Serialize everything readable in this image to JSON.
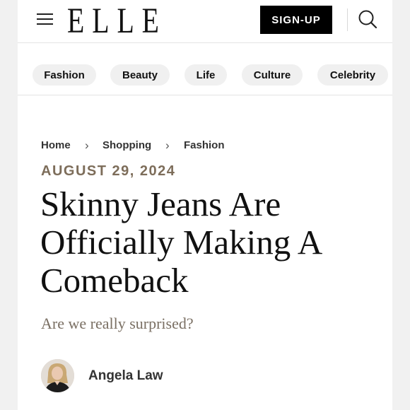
{
  "header": {
    "logo": "ELLE",
    "menu_icon": "hamburger-menu-icon",
    "signup_label": "SIGN-UP",
    "search_icon": "search-icon"
  },
  "categories": [
    "Fashion",
    "Beauty",
    "Life",
    "Culture",
    "Celebrity"
  ],
  "breadcrumb": [
    "Home",
    "Shopping",
    "Fashion"
  ],
  "article": {
    "date": "AUGUST 29, 2024",
    "headline": "Skinny Jeans Are Officially Making A Comeback",
    "dek": "Are we really surprised?",
    "author": "Angela Law"
  },
  "colors": {
    "accent_date": "#7d6d5a",
    "dek": "#7a6f63",
    "pill_bg": "#f0f0f0",
    "button_bg": "#000000"
  }
}
